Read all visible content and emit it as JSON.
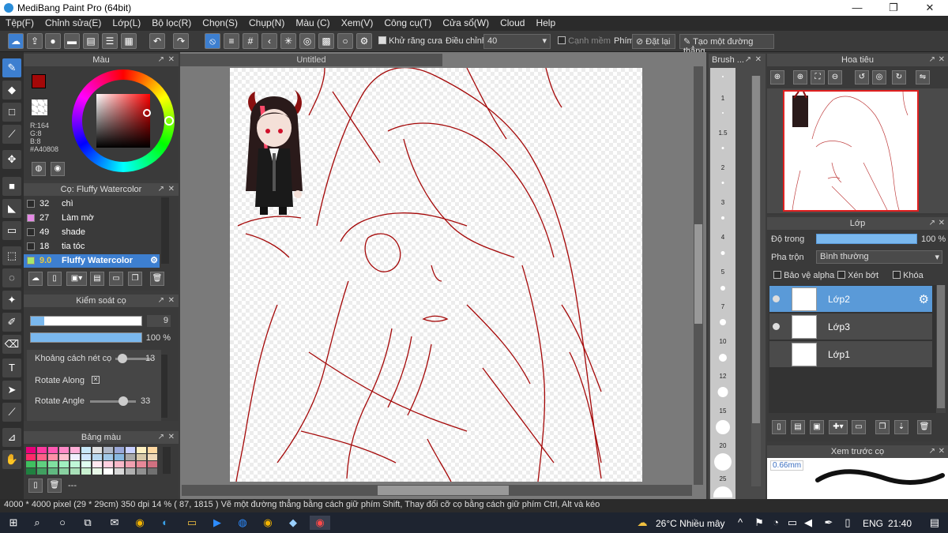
{
  "window": {
    "title": "MediBang Paint Pro (64bit)",
    "minimize": "—",
    "maximize": "❐",
    "close": "✕"
  },
  "menu": [
    "Tệp(F)",
    "Chỉnh sửa(E)",
    "Lớp(L)",
    "Bộ lọc(R)",
    "Chọn(S)",
    "Chụp(N)",
    "Màu (C)",
    "Xem(V)",
    "Công cụ(T)",
    "Cửa sổ(W)",
    "Cloud",
    "Help"
  ],
  "toolbar": {
    "antialias_label": "Khử răng cưa",
    "adjust_label": "Điều chỉnh",
    "adjust_value": "40",
    "edge_label": "Cạnh mềm",
    "key_label": "Phím",
    "reset_label": "Đặt lại",
    "straight_line_label": "Tạo một đường thẳng"
  },
  "color_panel": {
    "title": "Màu",
    "rgb_r": "R:164",
    "rgb_g": "G:8",
    "rgb_b": "B:8",
    "hex": "#A40808",
    "main_color": "#a40808"
  },
  "brush_panel": {
    "title": "Cọ: Fluffy Watercolor",
    "items": [
      {
        "size": "32",
        "name": "chì",
        "color": "#2a2a2a"
      },
      {
        "size": "27",
        "name": "Làm mờ",
        "color": "#e68ae6"
      },
      {
        "size": "49",
        "name": "shade",
        "color": "#2a2a2a"
      },
      {
        "size": "18",
        "name": "tia tóc",
        "color": "#2a2a2a"
      },
      {
        "size": "9.0",
        "name": "Fluffy Watercolor",
        "color": "#a8e86a"
      }
    ]
  },
  "brush_control": {
    "title": "Kiểm soát cọ",
    "size_value": "9",
    "opacity_value": "100 %",
    "spacing_label": "Khoảng cách nét cọ",
    "spacing_value": "13",
    "rotate_along_label": "Rotate Along",
    "rotate_angle_label": "Rotate Angle",
    "rotate_angle_value": "33",
    "size_fraction": 0.12,
    "opacity_fraction": 1.0
  },
  "palette": {
    "title": "Bảng màu",
    "footer": "---",
    "colors": [
      "#e8007a",
      "#ff3aa0",
      "#ff5ab4",
      "#ff8ac8",
      "#ffb0d8",
      "#c8e8f8",
      "#e0e0e0",
      "#b0b8c8",
      "#9aa8d8",
      "#c8d0ff",
      "#fff0c0",
      "#ffd8a0",
      "#ff2a6a",
      "#ff6088",
      "#ff90a8",
      "#ffc0d0",
      "#f0f0ff",
      "#d0e8ff",
      "#b8d8f0",
      "#a0c8e8",
      "#88b8e0",
      "#a8a8a8",
      "#d8c8a8",
      "#f0d8b8",
      "#40c060",
      "#60d080",
      "#80e0a0",
      "#a0f0c0",
      "#c0f8d8",
      "#e0fff0",
      "#ffe8f0",
      "#ffd0e0",
      "#f8b8c8",
      "#f0a0b0",
      "#e88898",
      "#d07080",
      "#208040",
      "#40a060",
      "#60b880",
      "#88d0a0",
      "#a8e0b8",
      "#c8f0d0",
      "#e8f8e8",
      "#ffffff",
      "#d8d8d8",
      "#b0b0b0",
      "#909090",
      "#707070"
    ]
  },
  "document": {
    "tab_title": "Untitled"
  },
  "brush_sizes": {
    "title": "Brush ...",
    "sizes": [
      "1",
      "1.5",
      "2",
      "3",
      "4",
      "5",
      "7",
      "10",
      "12",
      "15",
      "20",
      "25"
    ]
  },
  "navigator": {
    "title": "Hoa tiêu"
  },
  "layers": {
    "title": "Lớp",
    "opacity_label": "Độ trong",
    "opacity_value": "100 %",
    "blend_label": "Pha trộn",
    "blend_value": "Bình thường",
    "protect_alpha": "Bảo vệ alpha",
    "clipping": "Xén bớt",
    "lock": "Khóa",
    "items": [
      {
        "name": "Lớp2"
      },
      {
        "name": "Lớp3"
      },
      {
        "name": "Lớp1"
      }
    ]
  },
  "brush_preview": {
    "title": "Xem trước cọ",
    "size": "0.66mm"
  },
  "status": {
    "text": "4000 * 4000 pixel   (29 * 29cm)   350 dpi   14 %   ( 87, 1815 )   Vẽ một đường thẳng bằng cách giữ phím Shift, Thay đổi cỡ cọ bằng cách giữ phím Ctrl, Alt và kéo"
  },
  "taskbar": {
    "weather": "26°C  Nhiều mây",
    "lang": "ENG",
    "time": "21:40"
  }
}
